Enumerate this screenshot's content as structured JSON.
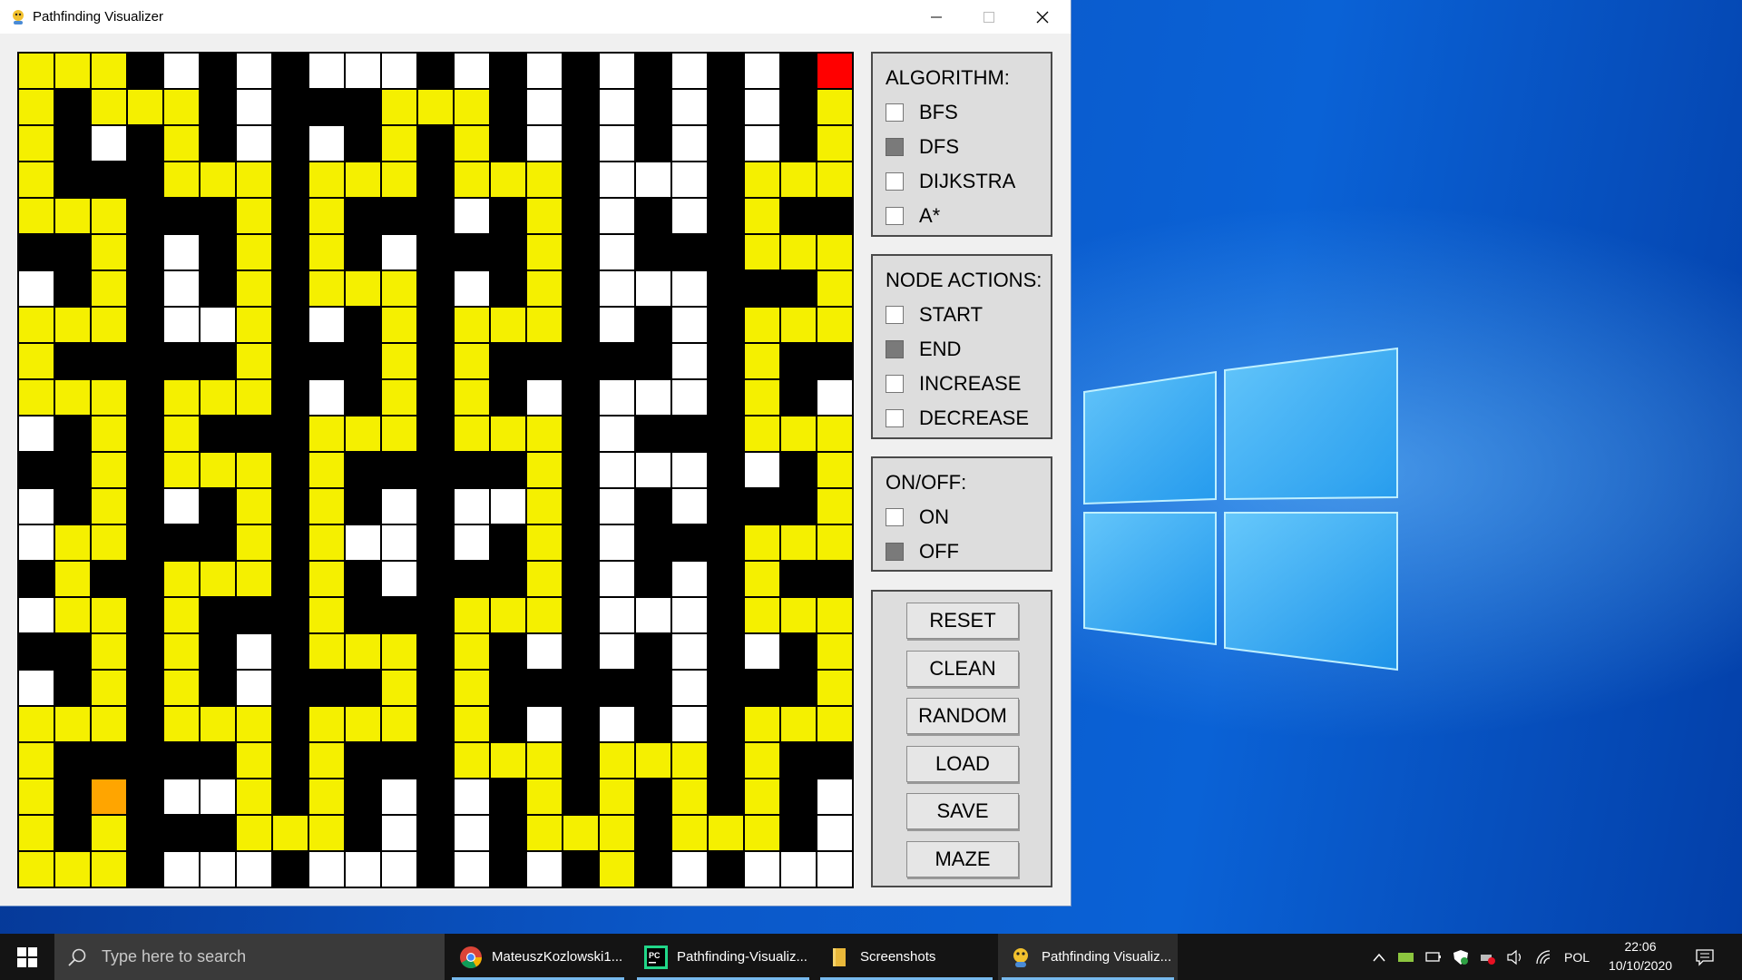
{
  "window": {
    "title": "Pathfinding Visualizer",
    "minimize": "—",
    "maximize": "☐",
    "close": "✕"
  },
  "colors": {
    "wall": "#000000",
    "empty": "#ffffff",
    "visited": "#f5f000",
    "start": "#ff0000",
    "end": "#ffa500"
  },
  "grid": {
    "rows": [
      "YYYBWBWBWWWBWBWBWBWBWBS",
      "YBYYYBWBBBYYYBWBWBWBWBY",
      "YBWBYBWBWBYBYBWBWBWBWBY",
      "YBBBYYYBYYYBYYYBWWWBYYY",
      "YYYBBBYBYBBBWBYBWBWBYBB",
      "BBYBWBYBYBWBBBYBWBBBYYY",
      "WBYBWBYBYYYBWBYBWWWBBBY",
      "YYYBWWYBWBYBYYYBWBWBYYY",
      "YBBBBBYBBBYBYBBBBBWBYBB",
      "YYYBYYYBWBYBYBWBWWWBYBW",
      "WBYBYBBBYYYBYYYBWBBBYYY",
      "BBYBYYYBYBBBBBYBWWWBWBY",
      "WBYBWBYBYBWBWWYBWBWBBBY",
      "WYYBBBYBYWWBWBYBWBBBYYY",
      "BYBBYYYBYBWBBBYBWBWBYBB",
      "WYYBYBBBYBBBYYYBWWWBYYY",
      "BBYBYBWBYYYBYBWBWBWBWBY",
      "WBYBYBWBBBYBYBBBBBWBBBY",
      "YYYBYYYBYYYBYBWBWBWBYYY",
      "YBBBBBYBYBBBYYYBYYYBYBB",
      "YBEBWWYBYBWBWBYBYBYBYBW",
      "YBYBBBYYYBWBWBYYYBYYYBW",
      "YYYBWWWBWWWBWBWBYBWBWWW"
    ]
  },
  "panels": {
    "algorithm": {
      "title": "ALGORITHM:",
      "options": [
        {
          "label": "BFS",
          "checked": false
        },
        {
          "label": "DFS",
          "checked": true
        },
        {
          "label": "DIJKSTRA",
          "checked": false
        },
        {
          "label": "A*",
          "checked": false
        }
      ]
    },
    "node_actions": {
      "title": "NODE ACTIONS:",
      "options": [
        {
          "label": "START",
          "checked": false
        },
        {
          "label": "END",
          "checked": true
        },
        {
          "label": "INCREASE",
          "checked": false
        },
        {
          "label": "DECREASE",
          "checked": false
        }
      ]
    },
    "on_off": {
      "title": "ON/OFF:",
      "options": [
        {
          "label": "ON",
          "checked": false
        },
        {
          "label": "OFF",
          "checked": true
        }
      ]
    },
    "buttons": [
      "RESET",
      "CLEAN",
      "RANDOM",
      "LOAD",
      "SAVE",
      "MAZE"
    ]
  },
  "taskbar": {
    "search_placeholder": "Type here to search",
    "items": [
      {
        "label": "MateuszKozlowski1...",
        "icon": "chrome-icon",
        "active": false
      },
      {
        "label": "Pathfinding-Visualiz...",
        "icon": "pycharm-icon",
        "active": false
      },
      {
        "label": "Screenshots",
        "icon": "folder-icon",
        "active": false
      },
      {
        "label": "Pathfinding Visualiz...",
        "icon": "pygame-icon",
        "active": true
      }
    ],
    "language": "POL",
    "time": "22:06",
    "date": "10/10/2020"
  }
}
